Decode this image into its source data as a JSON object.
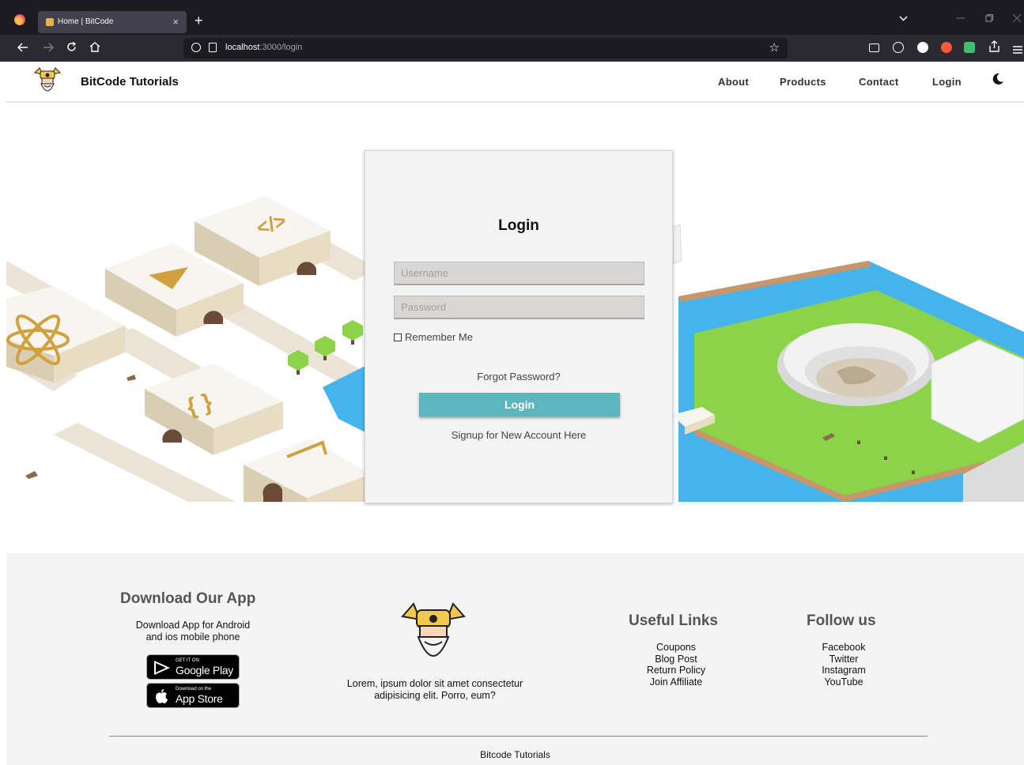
{
  "browser": {
    "tab_title": "Home | BitCode",
    "tab_close": "×",
    "new_tab": "+",
    "url_host": "localhost",
    "url_path": ":3000/login"
  },
  "header": {
    "brand": "BitCode Tutorials",
    "nav": [
      "About",
      "Products",
      "Contact",
      "Login"
    ]
  },
  "login": {
    "title": "Login",
    "username_placeholder": "Username",
    "password_placeholder": "Password",
    "remember_label": "Remember Me",
    "forgot": "Forgot Password?",
    "button": "Login",
    "signup": "Signup for New Account Here"
  },
  "footer": {
    "download_title": "Download Our App",
    "download_text_1": "Download App for Android",
    "download_text_2": "and ios mobile phone",
    "google_small": "GET IT ON",
    "google_big": "Google Play",
    "apple_small": "Download on the",
    "apple_big": "App Store",
    "about_1": "Lorem, ipsum dolor sit amet consectetur",
    "about_2": "adipisicing elit. Porro, eum?",
    "useful_title": "Useful Links",
    "useful_links": [
      "Coupons",
      "Blog Post",
      "Return Policy",
      "Join Affiliate"
    ],
    "follow_title": "Follow us",
    "follow_links": [
      "Facebook",
      "Twitter",
      "Instagram",
      "YouTube"
    ],
    "copyright": "Bitcode Tutorials"
  },
  "colors": {
    "accent": "#5cb6bd",
    "water": "#45b4ec",
    "grass": "#8bd44a",
    "sand": "#e5dccb"
  }
}
